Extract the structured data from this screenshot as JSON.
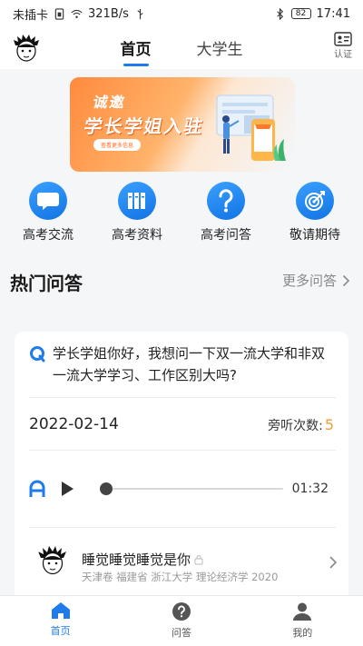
{
  "status_bar": {
    "sim": "未插卡",
    "speed": "321B/s",
    "battery": "82",
    "time": "17:41"
  },
  "header": {
    "tabs": [
      {
        "label": "首页",
        "active": true
      },
      {
        "label": "大学生",
        "active": false
      }
    ],
    "verify_label": "认证"
  },
  "banner": {
    "line1": "诚邀",
    "line2": "学长学姐入驻",
    "button": "查看更多信息"
  },
  "entries": [
    {
      "label": "高考交流",
      "icon": "chat-bubble-icon"
    },
    {
      "label": "高考资料",
      "icon": "books-icon"
    },
    {
      "label": "高考问答",
      "icon": "question-icon"
    },
    {
      "label": "敬请期待",
      "icon": "target-icon"
    }
  ],
  "section": {
    "title": "热门问答",
    "more": "更多问答"
  },
  "qa_card": {
    "question": "学长学姐你好，我想问一下双一流大学和非双一流大学学习、工作区别大吗?",
    "date": "2022-02-14",
    "listen_label": "旁听次数:",
    "listen_count": "5",
    "duration": "01:32",
    "progress": 0,
    "answerer": {
      "name": "睡觉睡觉睡觉是你",
      "info": "天津卷 福建省 浙江大学 理论经济学 2020"
    }
  },
  "bottom_nav": [
    {
      "label": "首页",
      "active": true
    },
    {
      "label": "问答",
      "active": false
    },
    {
      "label": "我的",
      "active": false
    }
  ],
  "colors": {
    "accent": "#1f7aea",
    "highlight": "#f29b38",
    "banner_orange": "#ff8a3d"
  }
}
